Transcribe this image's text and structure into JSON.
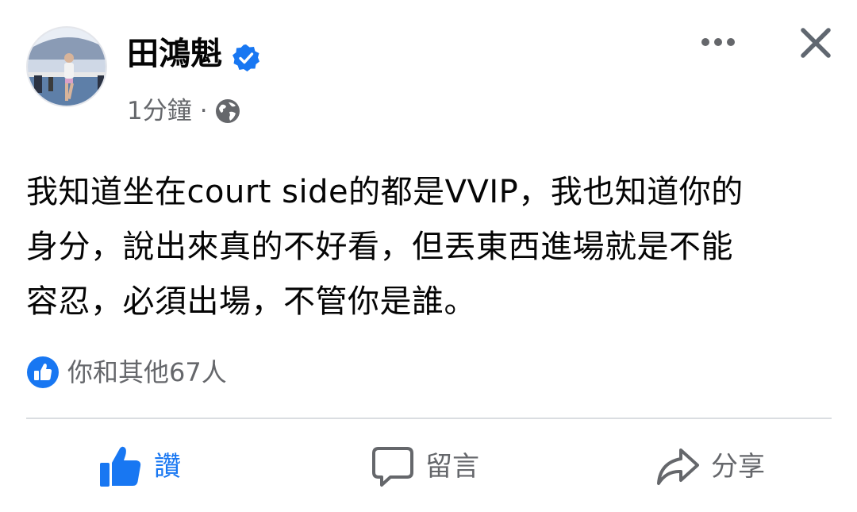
{
  "post": {
    "author": "田鴻魁",
    "verified": true,
    "time": "1分鐘",
    "separator": "·",
    "privacy_icon": "globe-icon",
    "text": "我知道坐在court side的都是VVIP，我也知道你的\n身分，說出來真的不好看，但丟東西進場就是不能\n容忍，必須出場，不管你是誰。"
  },
  "reactions": {
    "icon": "like-reaction-icon",
    "summary": "你和其他67人"
  },
  "actions": {
    "like_label": "讚",
    "comment_label": "留言",
    "share_label": "分享"
  },
  "colors": {
    "accent": "#1877f2",
    "secondary_text": "#65676b",
    "primary_text": "#050505",
    "divider": "#dadde1"
  }
}
